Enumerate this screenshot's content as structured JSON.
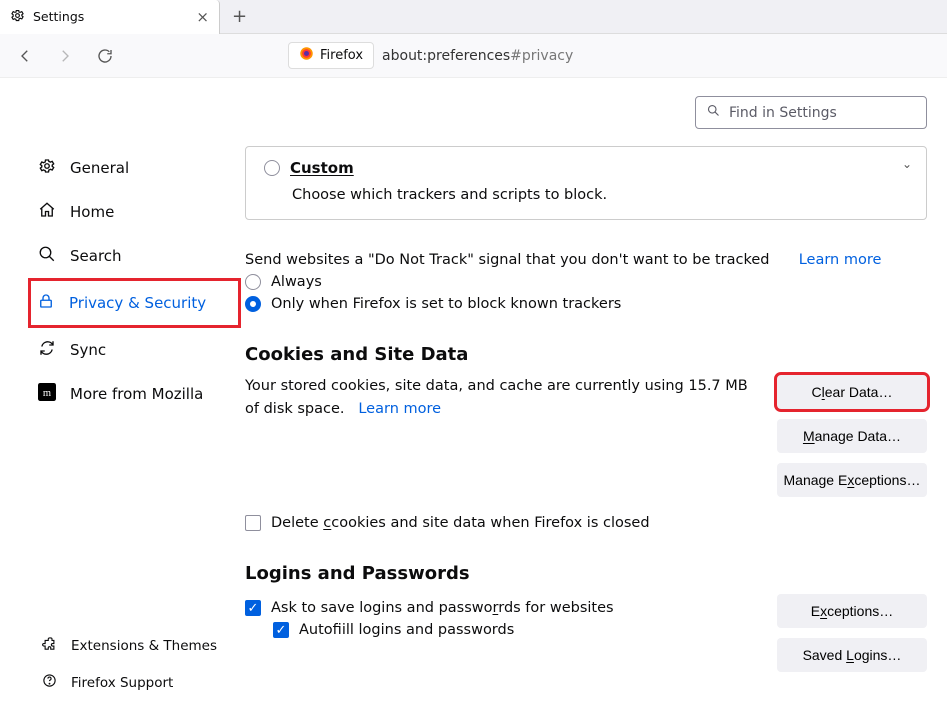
{
  "tab": {
    "title": "Settings"
  },
  "urlbar": {
    "identity": "Firefox",
    "url_prefix": "about:preferences",
    "url_hash": "#privacy"
  },
  "search": {
    "placeholder": "Find in Settings"
  },
  "sidebar": {
    "items": [
      {
        "label": "General"
      },
      {
        "label": "Home"
      },
      {
        "label": "Search"
      },
      {
        "label": "Privacy & Security"
      },
      {
        "label": "Sync"
      },
      {
        "label": "More from Mozilla"
      }
    ],
    "bottom": [
      {
        "label": "Extensions & Themes"
      },
      {
        "label": "Firefox Support"
      }
    ]
  },
  "custom": {
    "title": "Custom",
    "subtitle": "Choose which trackers and scripts to block."
  },
  "dnt": {
    "intro": "Send websites a \"Do Not Track\" signal that you don't want to be tracked",
    "learn": "Learn more",
    "opt_always": "Always",
    "opt_known": "Only when Firefox is set to block known trackers"
  },
  "cookies": {
    "heading": "Cookies and Site Data",
    "body_a": "Your stored cookies, site data, and cache are currently using ",
    "size": "15.7 MB",
    "body_b": " of disk space.",
    "learn": "Learn more",
    "delete_on_close_a": "Delete ",
    "delete_on_close_b": "cookies and site data when Firefox is closed",
    "buttons": {
      "clear": "Clear Data…",
      "manage": "Manage Data…",
      "exceptions": "Manage Exceptions…"
    }
  },
  "logins": {
    "heading": "Logins and Passwords",
    "ask_a": "Ask to save logins and passwo",
    "ask_b": "rds for websites",
    "autofill_a": "Autof",
    "autofill_b": "ill logins and passwords",
    "exceptions": "Exceptions…",
    "saved": "Saved Logins…"
  }
}
